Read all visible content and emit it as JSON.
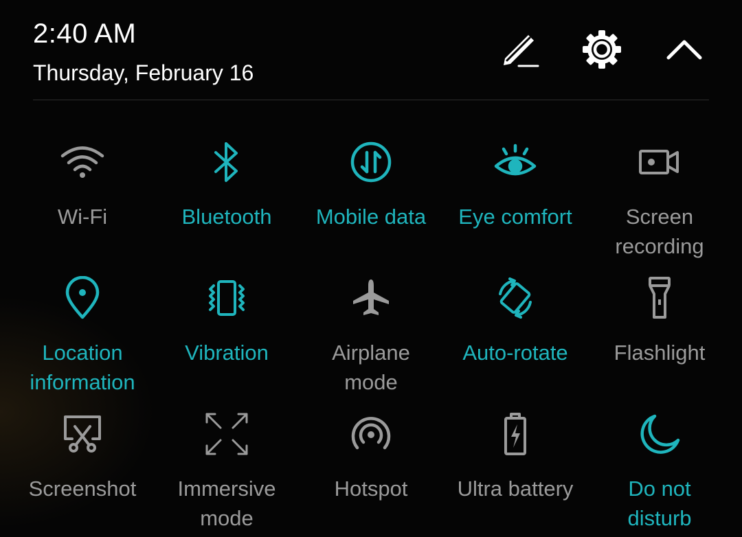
{
  "header": {
    "time": "2:40 AM",
    "date": "Thursday, February 16",
    "icons": [
      "edit-icon",
      "gear-icon",
      "chevron-up-icon"
    ]
  },
  "colors": {
    "active": "#1fb5bd",
    "inactive": "#9b9b9b",
    "background": "#050505"
  },
  "tiles": [
    {
      "label": "Wi-Fi",
      "icon": "wifi-icon",
      "state": "off"
    },
    {
      "label": "Bluetooth",
      "icon": "bluetooth-icon",
      "state": "on"
    },
    {
      "label": "Mobile data",
      "icon": "mobile-data-icon",
      "state": "on"
    },
    {
      "label": "Eye comfort",
      "icon": "eye-icon",
      "state": "on"
    },
    {
      "label": "Screen\nrecording",
      "icon": "video-camera-icon",
      "state": "off"
    },
    {
      "label": "Location\ninformation",
      "icon": "location-pin-icon",
      "state": "on"
    },
    {
      "label": "Vibration",
      "icon": "vibration-icon",
      "state": "on"
    },
    {
      "label": "Airplane\nmode",
      "icon": "airplane-icon",
      "state": "off"
    },
    {
      "label": "Auto-rotate",
      "icon": "auto-rotate-icon",
      "state": "on"
    },
    {
      "label": "Flashlight",
      "icon": "flashlight-icon",
      "state": "off"
    },
    {
      "label": "Screenshot",
      "icon": "screenshot-icon",
      "state": "off"
    },
    {
      "label": "Immersive\nmode",
      "icon": "immersive-icon",
      "state": "off"
    },
    {
      "label": "Hotspot",
      "icon": "hotspot-icon",
      "state": "off"
    },
    {
      "label": "Ultra battery",
      "icon": "battery-icon",
      "state": "off"
    },
    {
      "label": "Do not\ndisturb",
      "icon": "moon-icon",
      "state": "on"
    }
  ]
}
